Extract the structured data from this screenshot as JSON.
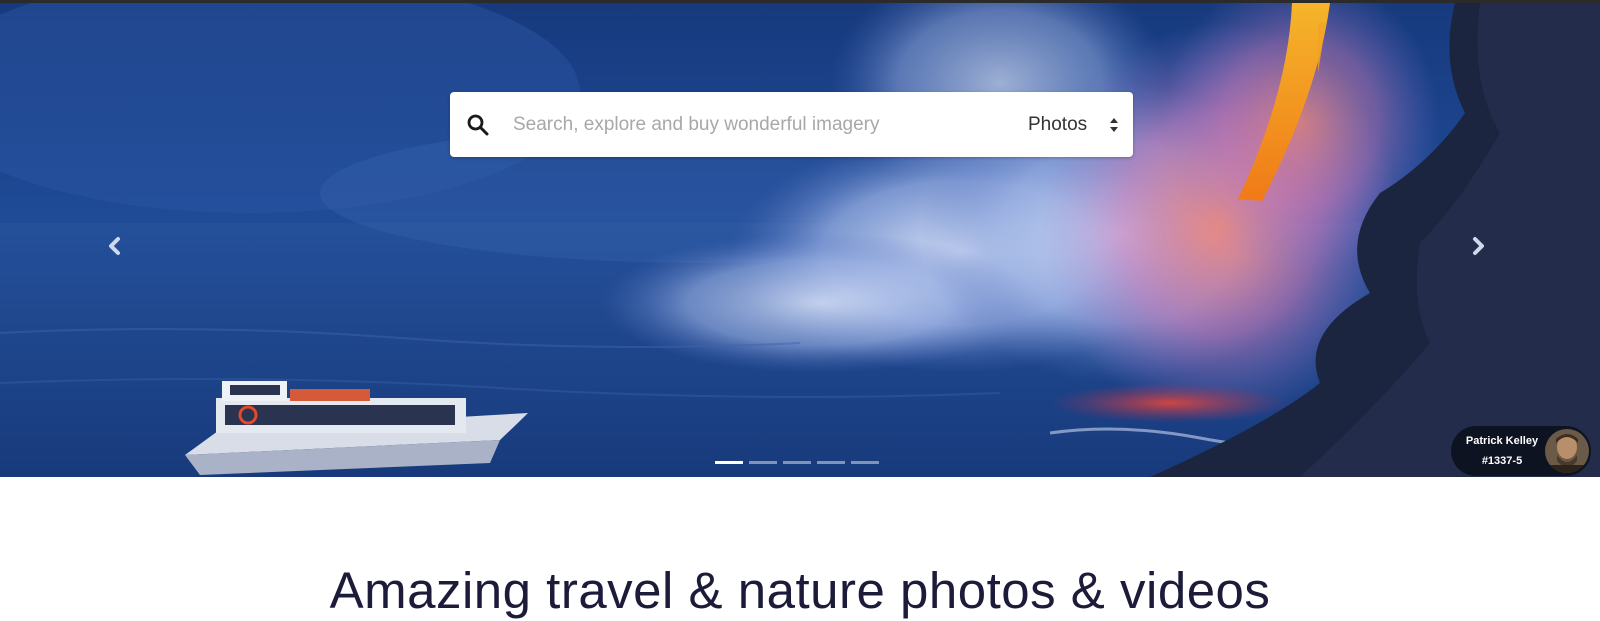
{
  "search": {
    "placeholder": "Search, explore and buy wonderful imagery",
    "value": "",
    "type_selected": "Photos"
  },
  "carousel": {
    "slide_count": 5,
    "active_slide": 1
  },
  "credit": {
    "photographer": "Patrick Kelley",
    "photo_id": "#1337-5"
  },
  "headline": "Amazing travel & nature photos & videos",
  "icons": {
    "search": "search-icon",
    "prev": "chevron-left-icon",
    "next": "chevron-right-icon",
    "select": "sort-arrows-icon"
  },
  "colors": {
    "hero_blue": "#1d3f86",
    "lava": "#f59a1c",
    "headline": "#1c1c3a"
  }
}
